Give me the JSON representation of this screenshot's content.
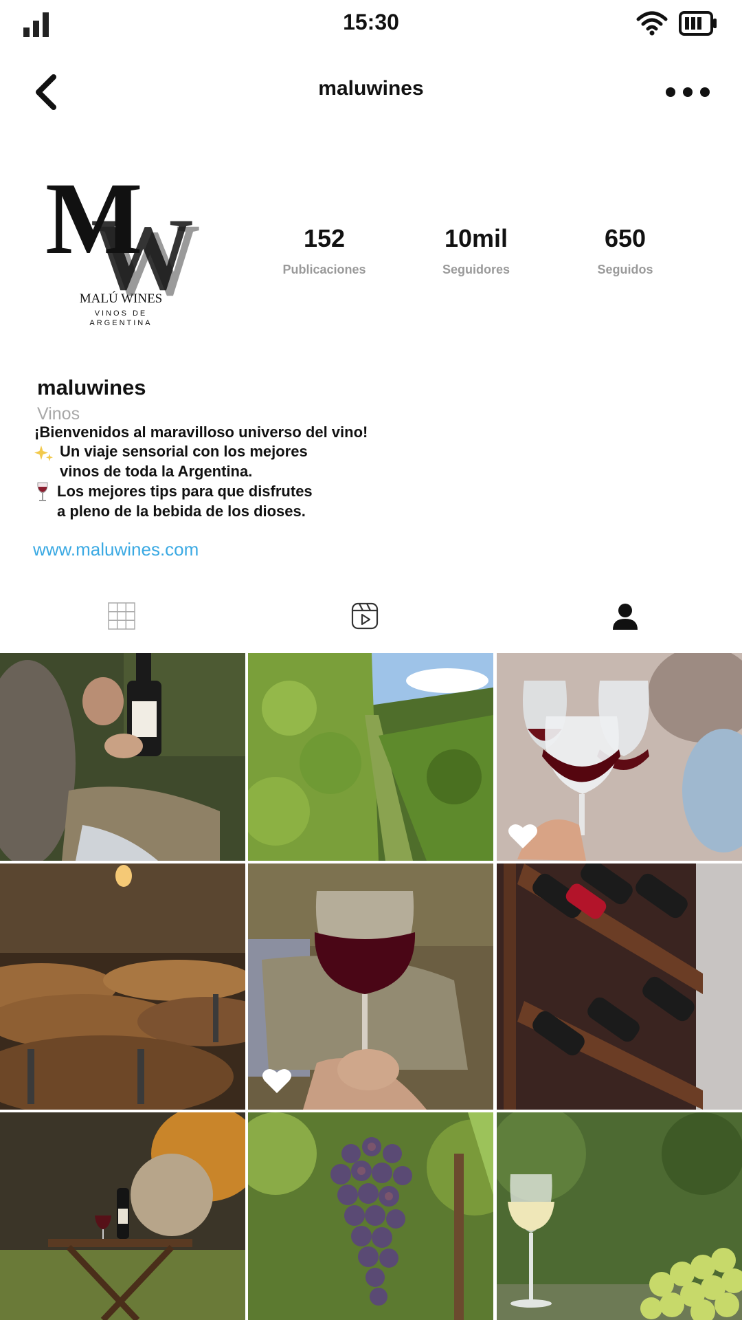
{
  "status_bar": {
    "time": "15:30"
  },
  "header": {
    "username": "maluwines"
  },
  "logo": {
    "monogram_top": "M",
    "monogram_bottom": "W",
    "brand": "MALÚ WINES",
    "tagline_1": "VINOS DE",
    "tagline_2": "ARGENTINA"
  },
  "stats": [
    {
      "value": "152",
      "label": "Publicaciones"
    },
    {
      "value": "10mil",
      "label": "Seguidores"
    },
    {
      "value": "650",
      "label": "Seguidos"
    }
  ],
  "bio": {
    "name": "maluwines",
    "category": "Vinos",
    "line_1": "¡Bienvenidos al maravilloso universo del vino!",
    "line_2": "Un viaje sensorial con los mejores",
    "line_3": "vinos de toda la Argentina.",
    "line_4": "Los mejores tips para que disfrutes",
    "line_5": "a pleno de la bebida de los dioses.",
    "link": "www.maluwines.com"
  },
  "tabs": [
    {
      "icon": "grid-icon",
      "active": false
    },
    {
      "icon": "reels-icon",
      "active": false
    },
    {
      "icon": "tagged-user-icon",
      "active": true
    }
  ],
  "grid": [
    {
      "subject": "man-holding-wine-bottle",
      "liked": false
    },
    {
      "subject": "vineyard-rows",
      "liked": false
    },
    {
      "subject": "red-wine-toast",
      "liked": true
    },
    {
      "subject": "wine-barrels-cellar",
      "liked": false
    },
    {
      "subject": "red-wine-glass-in-hand",
      "liked": true
    },
    {
      "subject": "wine-bottle-rack",
      "liked": false
    },
    {
      "subject": "outdoor-table-wine",
      "liked": false
    },
    {
      "subject": "grape-bunch",
      "liked": false
    },
    {
      "subject": "white-wine-glass-grapes",
      "liked": false
    }
  ],
  "colors": {
    "link": "#3aa9e3",
    "muted": "#9a9a9a",
    "text": "#111111"
  }
}
